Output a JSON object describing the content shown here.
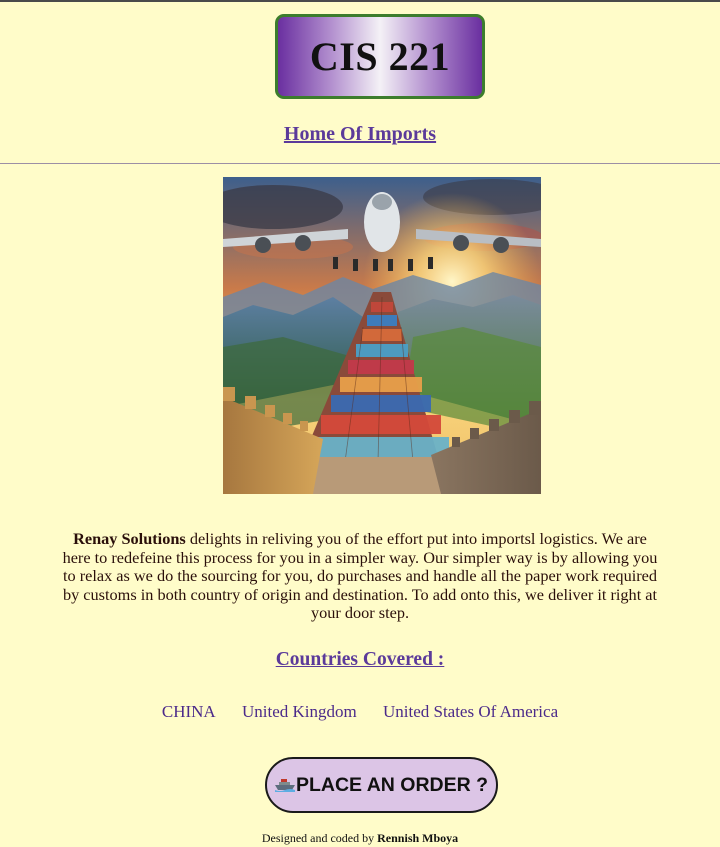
{
  "header": {
    "title": "CIS 221",
    "home_link": "Home Of Imports"
  },
  "hero": {
    "icon": "airplane-over-container-wall-image"
  },
  "description": {
    "company": "Renay Solutions",
    "text": " delights in reliving you of the effort put into importsl logistics. We are here to redefeine this process for you in a simpler way. Our simpler way is by allowing you to relax as we do the sourcing for you, do purchases and handle all the paper work required by customs in both country of origin and destination. To add onto this, we deliver it right at your door step."
  },
  "countries": {
    "heading": "Countries Covered :",
    "items": [
      "CHINA",
      "United Kingdom",
      "United States Of America"
    ]
  },
  "order_button": {
    "label": "PLACE AN ORDER ?",
    "icon": "ship-icon"
  },
  "footer": {
    "prefix": "Designed and coded by ",
    "author": "Rennish Mboya"
  },
  "colors": {
    "background": "#fffcc9",
    "link": "#5b3a9a",
    "title_border": "#3c7d2c",
    "button_bg": "#dcc5e6"
  }
}
